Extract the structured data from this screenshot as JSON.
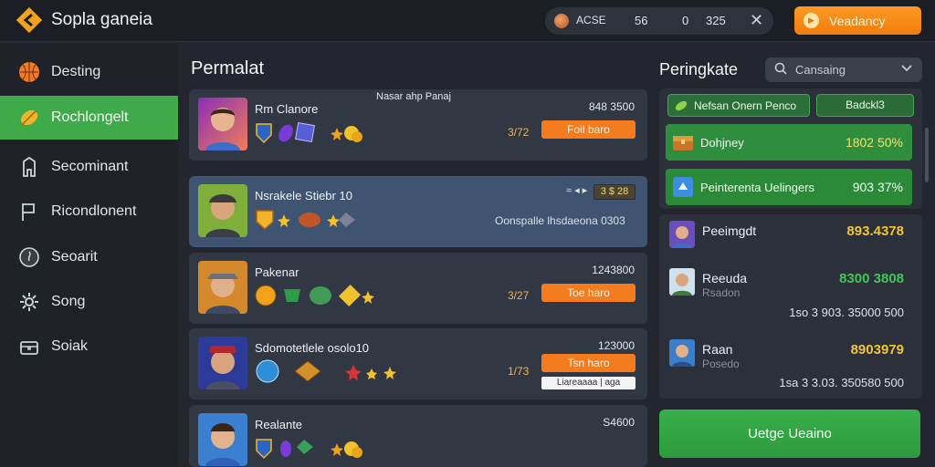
{
  "header": {
    "app_title": "Sopla ganeia",
    "stats": {
      "label": "ACSE",
      "v1": "56",
      "v2": "0",
      "v3": "325"
    },
    "cta_label": "Veadancy"
  },
  "sidebar": {
    "items": [
      {
        "label": "Desting",
        "icon": "basketball-icon"
      },
      {
        "label": "Rochlongelt",
        "icon": "leaf-icon",
        "active": true
      },
      {
        "label": "Secominant",
        "icon": "tower-icon"
      },
      {
        "label": "Ricondlonent",
        "icon": "flag-icon"
      },
      {
        "label": "Seoarit",
        "icon": "flame-icon"
      },
      {
        "label": "Song",
        "icon": "gear-icon"
      },
      {
        "label": "Soiak",
        "icon": "chest-icon"
      }
    ]
  },
  "main": {
    "title": "Permalat",
    "cards": [
      {
        "title": "Rm Clanore",
        "banner": "Nasar ahp Panaj",
        "top_right": "848 3500",
        "price": "3/72",
        "button": "Foil baro"
      },
      {
        "title": "Nsrakele Stiebr 10",
        "top_right_icon": "≈ ◂ ▸",
        "tag": "3 $ 28",
        "subtext": "Oonspalle lhsdaeona 0303"
      },
      {
        "title": "Pakenar",
        "top_right": "1243800",
        "price": "3/27",
        "button": "Toe haro"
      },
      {
        "title": "Sdomotetlele osolo10",
        "top_right": "123000",
        "price": "1/73",
        "button": "Tsn haro",
        "note": "Liareaaaa | aga"
      },
      {
        "title": "Realante",
        "top_right": "S4600"
      }
    ]
  },
  "right": {
    "title": "Peringkate",
    "search_placeholder": "Cansaing",
    "tab1": "Nefsan Onern Penco",
    "tab2": "Badckl3",
    "rows": [
      {
        "label": "Dohjney",
        "value": "1802 50%"
      },
      {
        "label": "Peinterenta Uelingers",
        "value": "903 37%"
      }
    ],
    "leaderboard": [
      {
        "name": "Peeimgdt",
        "score": "893.4378"
      },
      {
        "name": "Reeuda",
        "sub": "Rsadon",
        "score": "8300 3808",
        "meta": "1so 3  903. 35000 500"
      },
      {
        "name": "Raan",
        "sub": "Posedo",
        "score": "8903979",
        "meta": "1sa 3  3.03. 350580 500"
      }
    ],
    "cta": "Uetge Ueaino"
  },
  "colors": {
    "accent_green": "#3faa4a",
    "accent_orange": "#f47c1f",
    "gold": "#f3c52f"
  }
}
